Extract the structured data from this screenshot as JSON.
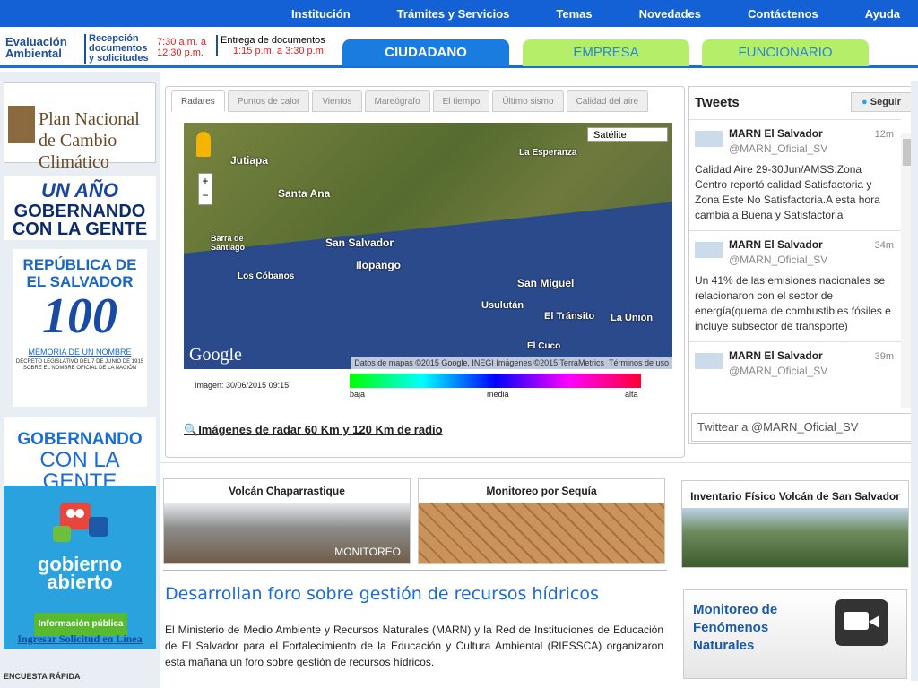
{
  "top_nav": [
    "Institución",
    "Trámites y Servicios",
    "Temas",
    "Novedades",
    "Contáctenos",
    "Ayuda"
  ],
  "info": {
    "ea1": "Evaluación",
    "ea2": "Ambiental",
    "rec1": "Recepción",
    "rec2": "documentos",
    "rec3": "y solicitudes",
    "rtime1": "7:30 a.m. a",
    "rtime2": "12:30 p.m.",
    "ent1": "Entrega de documentos",
    "ent2": "1:15 p.m. a 3:30 p.m."
  },
  "audience_tabs": [
    "CIUDADANO",
    "EMPRESA",
    "FUNCIONARIO"
  ],
  "left_banners": {
    "plan": "Plan Nacional de Cambio Climático",
    "unano_a": "UN AÑO",
    "unano_b1": "GOBERNANDO",
    "unano_b2": "CON LA GENTE",
    "rep_h1": "REPÚBLICA DE",
    "rep_h2": "EL SALVADOR",
    "rep_big": "100",
    "rep_m": "MEMORIA DE UN NOMBRE",
    "rep_d": "DECRETO LEGISLATIVO DEL 7 DE JUNIO DE 1915 SOBRE EL NOMBRE OFICIAL DE LA NACIÓN",
    "gob1": "GOBERNANDO",
    "gob2": "CON LA GENTE",
    "ga1": "gobierno",
    "ga2": "abierto",
    "ga_btn": "Información pública",
    "ingresar": "Ingresar Solicitud en Línea",
    "encuesta": "ENCUESTA RÁPIDA"
  },
  "radar_tabs": [
    "Radares",
    "Puntos de calor",
    "Vientos",
    "Mareógrafo",
    "El tiempo",
    "Último sismo",
    "Calidad del aire"
  ],
  "map": {
    "map_type": "Satélite",
    "labels": [
      "Jutiapa",
      "Santa Ana",
      "San Salvador",
      "Ilopango",
      "Los Cóbanos",
      "San Miguel",
      "Usulután",
      "El Tránsito",
      "La Unión",
      "La Esperanza",
      "El Cuco",
      "Barra de Santiago"
    ],
    "attribution": "Datos de mapas ©2015 Google, INEGI Imágenes ©2015 TerraMetrics",
    "terms": "Términos de uso",
    "image_date": "Imagen: 30/06/2015 09:15",
    "scale": [
      "baja",
      "media",
      "alta"
    ],
    "link": "Imágenes de radar 60 Km y 120 Km de radio"
  },
  "tweets": {
    "title": "Tweets",
    "follow": "Seguir",
    "items": [
      {
        "name": "MARN El Salvador",
        "user": "@MARN_Oficial_SV",
        "time": "12m",
        "text": "Calidad Aire 29-30Jun/AMSS:Zona Centro reportó calidad Satisfactoria y Zona Este No Satisfactoria.A esta hora cambia a Buena y Satisfactoria"
      },
      {
        "name": "MARN El Salvador",
        "user": "@MARN_Oficial_SV",
        "time": "34m",
        "text": "Un 41% de las emisiones nacionales se relacionaron con el sector de energía(quema de combustibles fósiles e incluye subsector de transporte)"
      },
      {
        "name": "MARN El Salvador",
        "user": "@MARN_Oficial_SV",
        "time": "39m",
        "text": ""
      }
    ],
    "compose_placeholder": "Twittear a @MARN_Oficial_SV"
  },
  "features": {
    "volcan": "Volcán Chaparrastique",
    "volcan_tag": "MONITOREO",
    "sequia": "Monitoreo por Sequía",
    "inventario": "Inventario Físico Volcán de San Salvador"
  },
  "news": {
    "headline": "Desarrollan foro sobre gestión de recursos hídricos",
    "body": "El Ministerio de Medio Ambiente y Recursos Naturales (MARN) y la Red de Instituciones de Educación de El Salvador para el Fortalecimiento de la Educación y Cultura Ambiental (RIESSCA) organizaron esta mañana un foro sobre gestión de recursos hídricos."
  },
  "monitoreo": {
    "l1": "Monitoreo de",
    "l2": "Fenómenos",
    "l3": "Naturales"
  },
  "colors": {
    "nav": "#1361d4",
    "ciudadano": "#1a7be0",
    "empresa": "#b5ef6a"
  }
}
